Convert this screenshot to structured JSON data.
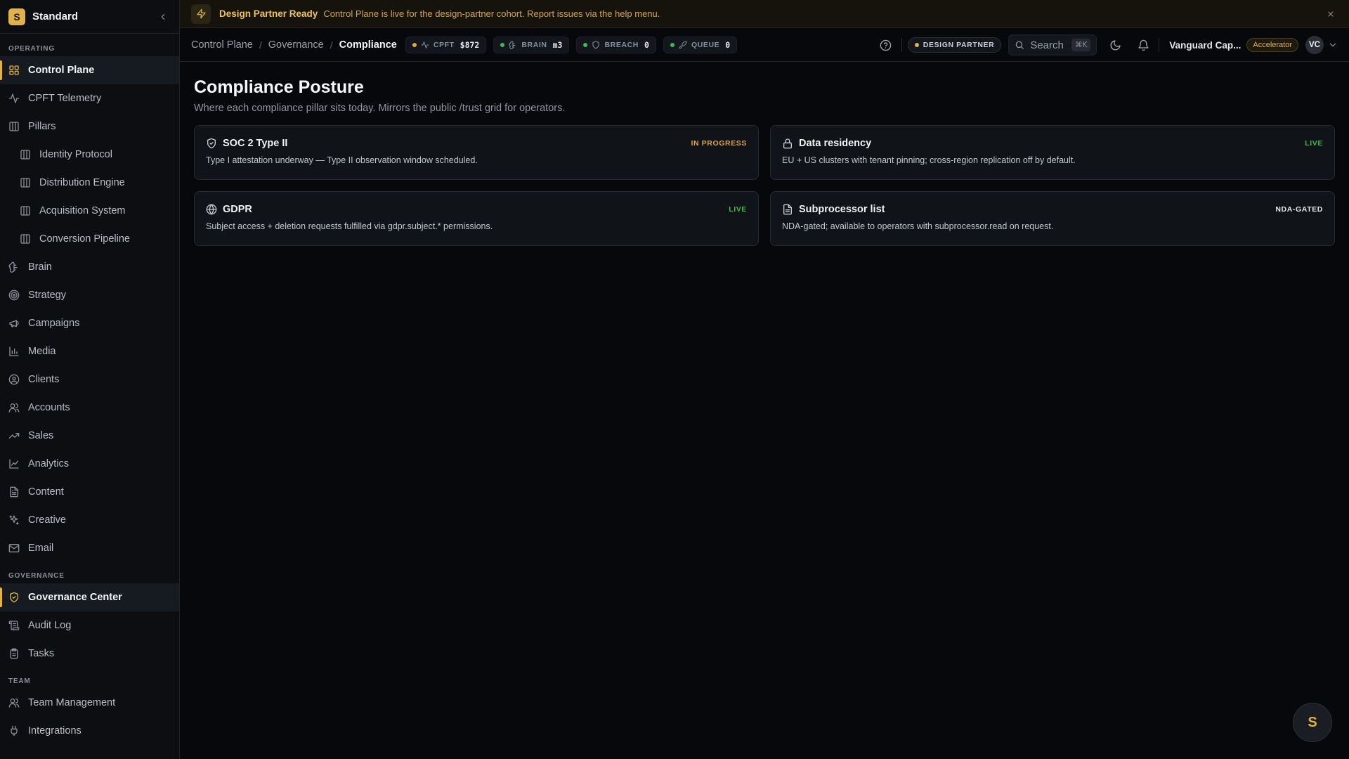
{
  "colors": {
    "accent": "#e0b24a",
    "live": "#3fb950",
    "in_progress": "#e0a63a",
    "nda": "#e6e8ec",
    "metric_amber": "#e0a63a",
    "metric_green": "#3fb950"
  },
  "sidebar": {
    "brand": {
      "logo": "S",
      "name": "Standard"
    },
    "sections": [
      {
        "label": "OPERATING",
        "items": [
          {
            "label": "Control Plane",
            "icon": "grid-icon",
            "active": true
          },
          {
            "label": "CPFT Telemetry",
            "icon": "activity-icon"
          },
          {
            "label": "Pillars",
            "icon": "columns-icon"
          },
          {
            "label": "Identity Protocol",
            "icon": "columns-icon",
            "sub": true
          },
          {
            "label": "Distribution Engine",
            "icon": "columns-icon",
            "sub": true
          },
          {
            "label": "Acquisition System",
            "icon": "columns-icon",
            "sub": true
          },
          {
            "label": "Conversion Pipeline",
            "icon": "columns-icon",
            "sub": true
          },
          {
            "label": "Brain",
            "icon": "brain-icon"
          },
          {
            "label": "Strategy",
            "icon": "target-icon"
          },
          {
            "label": "Campaigns",
            "icon": "megaphone-icon"
          },
          {
            "label": "Media",
            "icon": "bar-chart-icon"
          },
          {
            "label": "Clients",
            "icon": "user-circle-icon"
          },
          {
            "label": "Accounts",
            "icon": "users-icon"
          },
          {
            "label": "Sales",
            "icon": "trending-up-icon"
          },
          {
            "label": "Analytics",
            "icon": "line-chart-icon"
          },
          {
            "label": "Content",
            "icon": "file-text-icon"
          },
          {
            "label": "Creative",
            "icon": "sparkles-icon"
          },
          {
            "label": "Email",
            "icon": "mail-icon"
          }
        ]
      },
      {
        "label": "GOVERNANCE",
        "items": [
          {
            "label": "Governance Center",
            "icon": "shield-check-icon",
            "active": true
          },
          {
            "label": "Audit Log",
            "icon": "scroll-icon"
          },
          {
            "label": "Tasks",
            "icon": "clipboard-icon"
          }
        ]
      },
      {
        "label": "TEAM",
        "items": [
          {
            "label": "Team Management",
            "icon": "users-icon"
          },
          {
            "label": "Integrations",
            "icon": "plug-icon"
          }
        ]
      }
    ]
  },
  "banner": {
    "title": "Design Partner Ready",
    "text": "Control Plane is live for the design-partner cohort. Report issues via the help menu."
  },
  "header": {
    "breadcrumbs": [
      "Control Plane",
      "Governance",
      "Compliance"
    ],
    "metrics": [
      {
        "label": "CPFT",
        "value": "$872",
        "icon": "activity-icon",
        "dot": "#e0a63a"
      },
      {
        "label": "BRAIN",
        "value": "m3",
        "icon": "brain-icon",
        "dot": "#3fb950"
      },
      {
        "label": "BREACH",
        "value": "0",
        "icon": "shield-icon",
        "dot": "#3fb950"
      },
      {
        "label": "QUEUE",
        "value": "0",
        "icon": "rocket-icon",
        "dot": "#3fb950"
      }
    ],
    "partner_pill": "DESIGN PARTNER",
    "search": {
      "label": "Search",
      "shortcut": "⌘K"
    },
    "org": {
      "name": "Vanguard Cap...",
      "badge": "Accelerator",
      "avatar": "VC"
    }
  },
  "main": {
    "title": "Compliance Posture",
    "subtitle": "Where each compliance pillar sits today. Mirrors the public /trust grid for operators.",
    "cards": [
      {
        "title": "SOC 2 Type II",
        "icon": "shield-check-icon",
        "status": "IN PROGRESS",
        "status_color": "#e0a63a",
        "desc": "Type I attestation underway — Type II observation window scheduled."
      },
      {
        "title": "Data residency",
        "icon": "lock-icon",
        "status": "LIVE",
        "status_color": "#3fb950",
        "desc": "EU + US clusters with tenant pinning; cross-region replication off by default."
      },
      {
        "title": "GDPR",
        "icon": "globe-icon",
        "status": "LIVE",
        "status_color": "#3fb950",
        "desc": "Subject access + deletion requests fulfilled via gdpr.subject.* permissions."
      },
      {
        "title": "Subprocessor list",
        "icon": "document-icon",
        "status": "NDA-GATED",
        "status_color": "#e6e8ec",
        "desc": "NDA-gated; available to operators with subprocessor.read on request."
      }
    ]
  },
  "fab": {
    "label": "S"
  }
}
